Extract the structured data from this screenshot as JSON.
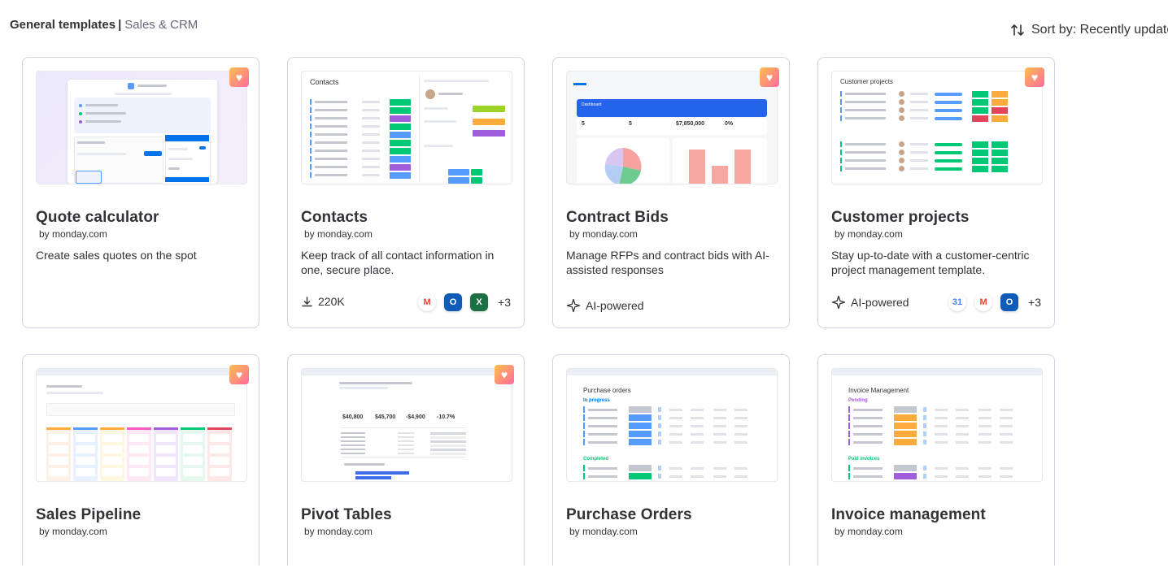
{
  "header": {
    "breadcrumb_bold": "General templates",
    "breadcrumb_sep": "|",
    "breadcrumb_category": "Sales & CRM",
    "sort_label": "Sort by: Recently updated",
    "sort_icon": "sort-arrows-icon"
  },
  "colors": {
    "accent": "#0073ea",
    "card_border": "#d0d4e4",
    "green": "#00c875",
    "orange": "#fdab3d",
    "red": "#e2445c",
    "purple": "#a25ddc",
    "blue": "#579bfc"
  },
  "cards": [
    {
      "title": "Quote calculator",
      "by": "by monday.com",
      "description": "Create sales quotes on the spot",
      "favorite_icon": "heart-icon"
    },
    {
      "title": "Contacts",
      "by": "by monday.com",
      "description": "Keep track of all contact information in one, secure place.",
      "downloads": "220K",
      "download_icon": "download-icon",
      "apps": [
        "gmail-icon",
        "outlook-icon",
        "excel-icon"
      ],
      "more_apps": "+3",
      "thumb_heading": "Contacts"
    },
    {
      "title": "Contract Bids",
      "by": "by monday.com",
      "description": "Manage RFPs and contract bids with AI-assisted responses",
      "badge": "AI-powered",
      "badge_icon": "sparkle-icon",
      "favorite_icon": "heart-icon",
      "thumb_stats": [
        "5",
        "5",
        "$7,850,000",
        "0%"
      ],
      "thumb_banner": "Dashboard"
    },
    {
      "title": "Customer projects",
      "by": "by monday.com",
      "description": "Stay up-to-date with a customer-centric project management template.",
      "badge": "AI-powered",
      "badge_icon": "sparkle-icon",
      "apps": [
        "google-calendar-icon",
        "gmail-icon",
        "outlook-icon"
      ],
      "more_apps": "+3",
      "favorite_icon": "heart-icon",
      "thumb_heading": "Customer projects"
    },
    {
      "title": "Sales Pipeline",
      "by": "by monday.com",
      "favorite_icon": "heart-icon"
    },
    {
      "title": "Pivot Tables",
      "by": "by monday.com",
      "favorite_icon": "heart-icon",
      "thumb_stats": [
        "$40,800",
        "$45,700",
        "-$4,900",
        "-10.7%"
      ]
    },
    {
      "title": "Purchase Orders",
      "by": "by monday.com",
      "thumb_heading": "Purchase orders",
      "thumb_groups": [
        "In progress",
        "Completed"
      ]
    },
    {
      "title": "Invoice management",
      "by": "by monday.com",
      "thumb_heading": "Invoice Management",
      "thumb_groups": [
        "Pending",
        "Paid invoices"
      ]
    }
  ]
}
